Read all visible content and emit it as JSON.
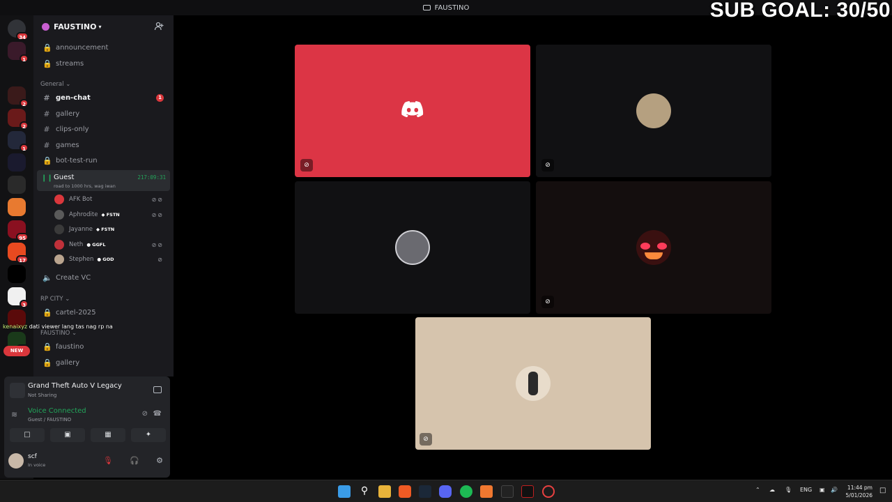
{
  "topbar": {
    "title": "FAUSTINO"
  },
  "overlay": {
    "sub_goal": "SUB GOAL: 30/50"
  },
  "rail": {
    "servers": [
      {
        "name": "direct-messages",
        "badge": "34"
      },
      {
        "name": "server-1",
        "badge": "1"
      },
      {
        "name": "folder",
        "badge": ""
      },
      {
        "name": "server-3",
        "badge": "2"
      },
      {
        "name": "server-4",
        "badge": "2"
      },
      {
        "name": "server-5",
        "badge": "1"
      },
      {
        "name": "server-6",
        "badge": ""
      },
      {
        "name": "server-7",
        "badge": ""
      },
      {
        "name": "server-8",
        "badge": ""
      },
      {
        "name": "server-9",
        "badge": "95"
      },
      {
        "name": "server-10",
        "badge": "17"
      },
      {
        "name": "server-11",
        "badge": ""
      },
      {
        "name": "server-12",
        "badge": "3"
      },
      {
        "name": "server-13",
        "badge": ""
      },
      {
        "name": "server-14",
        "badge": "39"
      }
    ],
    "new_label": "NEW"
  },
  "guild": {
    "name": "FAUSTINO"
  },
  "channels_top": [
    {
      "name": "announcement",
      "icon": "lock"
    },
    {
      "name": "streams",
      "icon": "lock"
    }
  ],
  "categories": {
    "general": "General",
    "rp_city": "RP CITY",
    "faustino": "FAUSTINO"
  },
  "channels_general": [
    {
      "name": "gen-chat",
      "icon": "hash",
      "unread": "1"
    },
    {
      "name": "gallery",
      "icon": "hash"
    },
    {
      "name": "clips-only",
      "icon": "hash"
    },
    {
      "name": "games",
      "icon": "hash"
    },
    {
      "name": "bot-test-run",
      "icon": "lock"
    }
  ],
  "voice_channel": {
    "name": "Guest",
    "status": "road to 1000 hrs, wag iwan",
    "timer": "217:09:31",
    "members": [
      {
        "name": "AFK Bot",
        "tag": "",
        "color": "#da373c"
      },
      {
        "name": "Aphrodite",
        "tag": "FSTN",
        "color": "#5a5a5a"
      },
      {
        "name": "Jayanne",
        "tag": "FSTN",
        "color": "#3a3a3a"
      },
      {
        "name": "Neth",
        "tag": "GGFL",
        "color": "#c0313a"
      },
      {
        "name": "Stephen",
        "tag": "GOD",
        "color": "#b9a48e"
      }
    ]
  },
  "create_vc": "Create VC",
  "channels_rp": [
    {
      "name": "cartel-2025",
      "icon": "lock"
    }
  ],
  "channels_faustino": [
    {
      "name": "faustino",
      "icon": "lock"
    },
    {
      "name": "gallery",
      "icon": "lock"
    }
  ],
  "chat_overlay": {
    "user": "kenaixyz",
    "message": "dati viewer lang tas nag rp na"
  },
  "activity": {
    "game": "Grand Theft Auto V Legacy",
    "status": "Not Sharing"
  },
  "voice": {
    "status": "Voice Connected",
    "location": "Guest / FAUSTINO"
  },
  "user": {
    "name": "scf",
    "status": "In voice"
  },
  "tiles": [
    {
      "name": "discord-default",
      "bg": "#dc3545"
    },
    {
      "name": "user-2",
      "bg": "#111113"
    },
    {
      "name": "user-3",
      "bg": "#111113"
    },
    {
      "name": "user-4",
      "bg": "#140e0e"
    },
    {
      "name": "user-5",
      "bg": "#d6c4ad"
    }
  ],
  "taskbar": {
    "language": "ENG",
    "time": "11:44 pm",
    "date": "5/01/2026"
  }
}
